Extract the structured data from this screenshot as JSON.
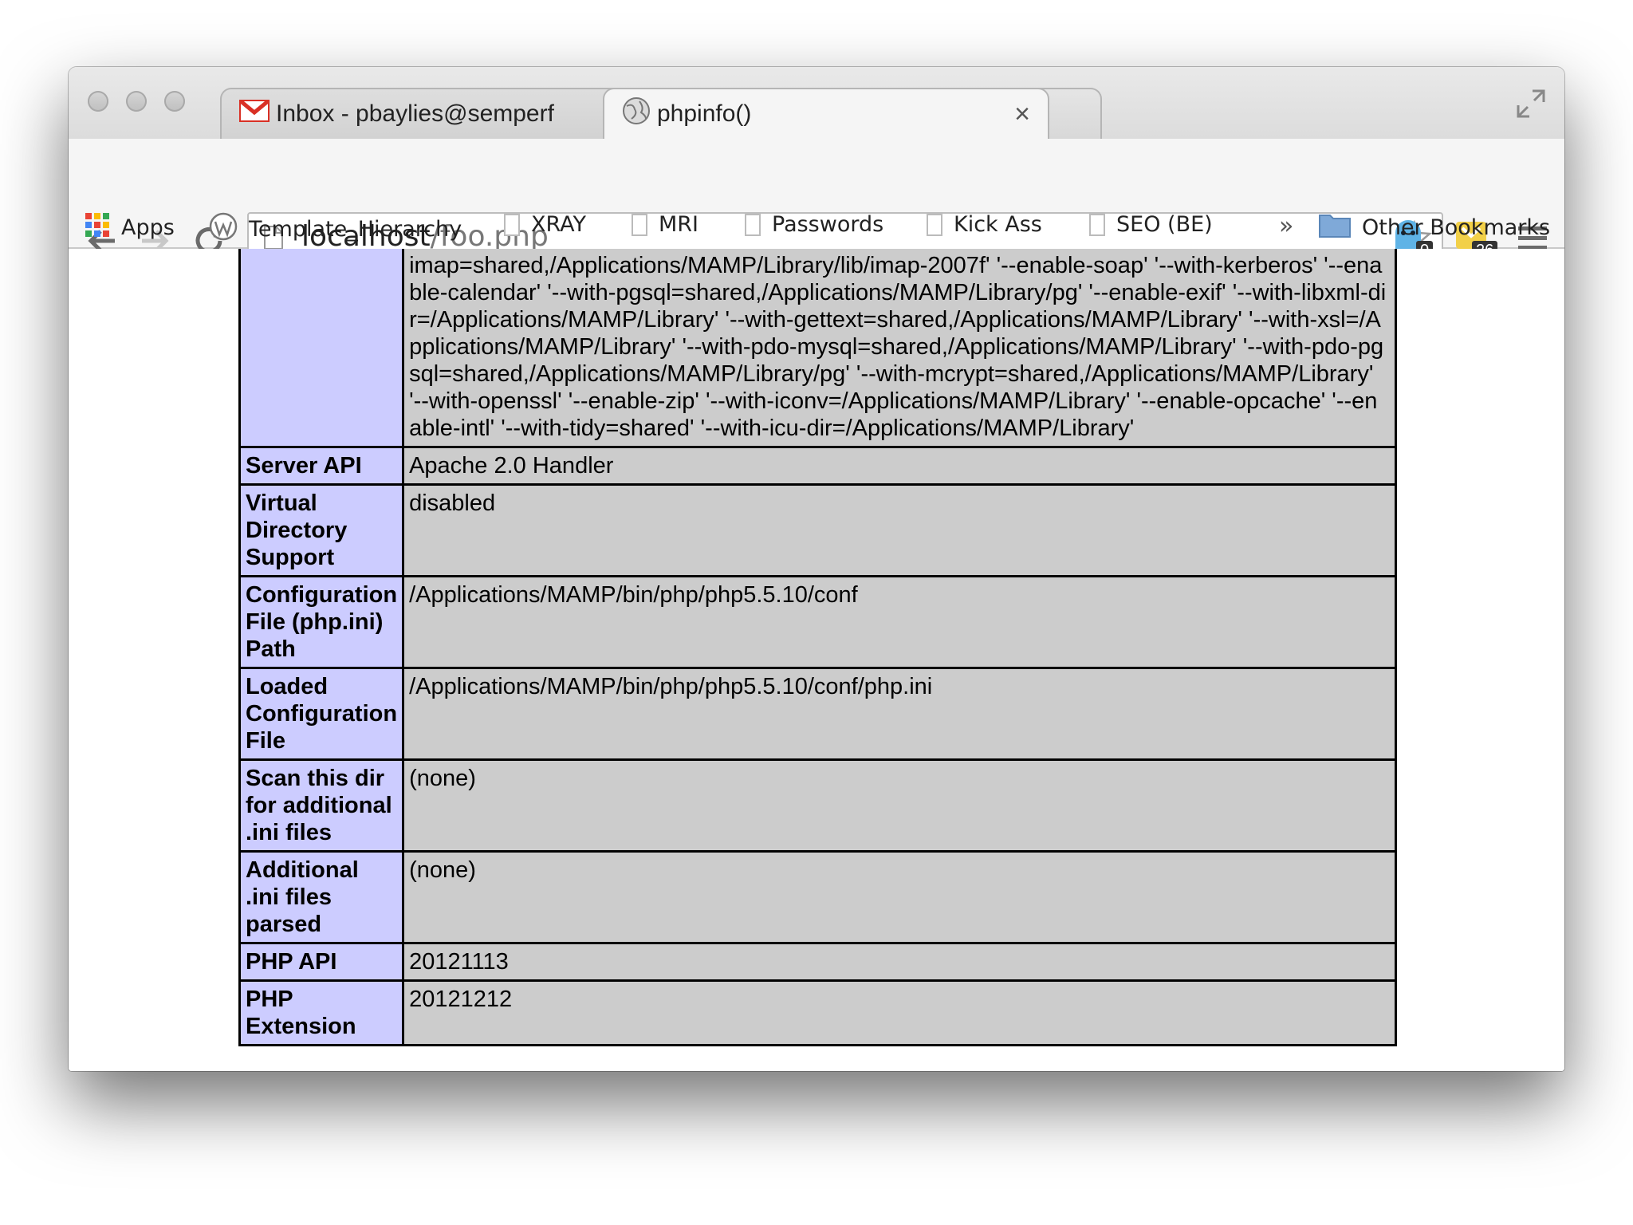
{
  "browser": {
    "tabs": [
      {
        "title": "Inbox - pbaylies@semperf",
        "icon": "gmail-icon",
        "close": "×"
      },
      {
        "title": "phpinfo()",
        "icon": "globe-icon",
        "close": "×"
      }
    ],
    "address": {
      "host": "localhost",
      "path": "/foo.php"
    },
    "extensions": [
      {
        "icon": "ghostery-icon",
        "badge": "0"
      },
      {
        "icon": "extension-mail-icon",
        "badge": "26"
      }
    ],
    "bookmarks": [
      {
        "label": "Apps",
        "icon": "apps-grid-icon"
      },
      {
        "label": "Template_Hierarchy",
        "icon": "wordpress-icon"
      },
      {
        "label": "XRAY",
        "icon": "page-icon"
      },
      {
        "label": "MRI",
        "icon": "page-icon"
      },
      {
        "label": "Passwords",
        "icon": "page-icon"
      },
      {
        "label": "Kick Ass",
        "icon": "page-icon"
      },
      {
        "label": "SEO (BE)",
        "icon": "page-icon"
      }
    ],
    "bookmarks_overflow": "»",
    "other_bookmarks": "Other Bookmarks"
  },
  "phpinfo": {
    "configure_tail": "imap=shared,/Applications/MAMP/Library/lib/imap-2007f' '--enable-soap' '--with-kerberos' '--enable-calendar' '--with-pgsql=shared,/Applications/MAMP/Library/pg' '--enable-exif' '--with-libxml-dir=/Applications/MAMP/Library' '--with-gettext=shared,/Applications/MAMP/Library' '--with-xsl=/Applications/MAMP/Library' '--with-pdo-mysql=shared,/Applications/MAMP/Library' '--with-pdo-pgsql=shared,/Applications/MAMP/Library/pg' '--with-mcrypt=shared,/Applications/MAMP/Library' '--with-openssl' '--enable-zip' '--with-iconv=/Applications/MAMP/Library' '--enable-opcache' '--enable-intl' '--with-tidy=shared' '--with-icu-dir=/Applications/MAMP/Library'",
    "rows": [
      {
        "key": "Server API",
        "value": "Apache 2.0 Handler"
      },
      {
        "key": "Virtual Directory Support",
        "value": "disabled"
      },
      {
        "key": "Configuration File (php.ini) Path",
        "value": "/Applications/MAMP/bin/php/php5.5.10/conf"
      },
      {
        "key": "Loaded Configuration File",
        "value": "/Applications/MAMP/bin/php/php5.5.10/conf/php.ini"
      },
      {
        "key": "Scan this dir for additional .ini files",
        "value": "(none)"
      },
      {
        "key": "Additional .ini files parsed",
        "value": "(none)"
      },
      {
        "key": "PHP API",
        "value": "20121113"
      },
      {
        "key": "PHP Extension",
        "value": "20121212"
      }
    ]
  },
  "colors": {
    "key_cell": "#ccccff",
    "value_cell": "#cccccc",
    "gmail_red": "#d93025"
  }
}
